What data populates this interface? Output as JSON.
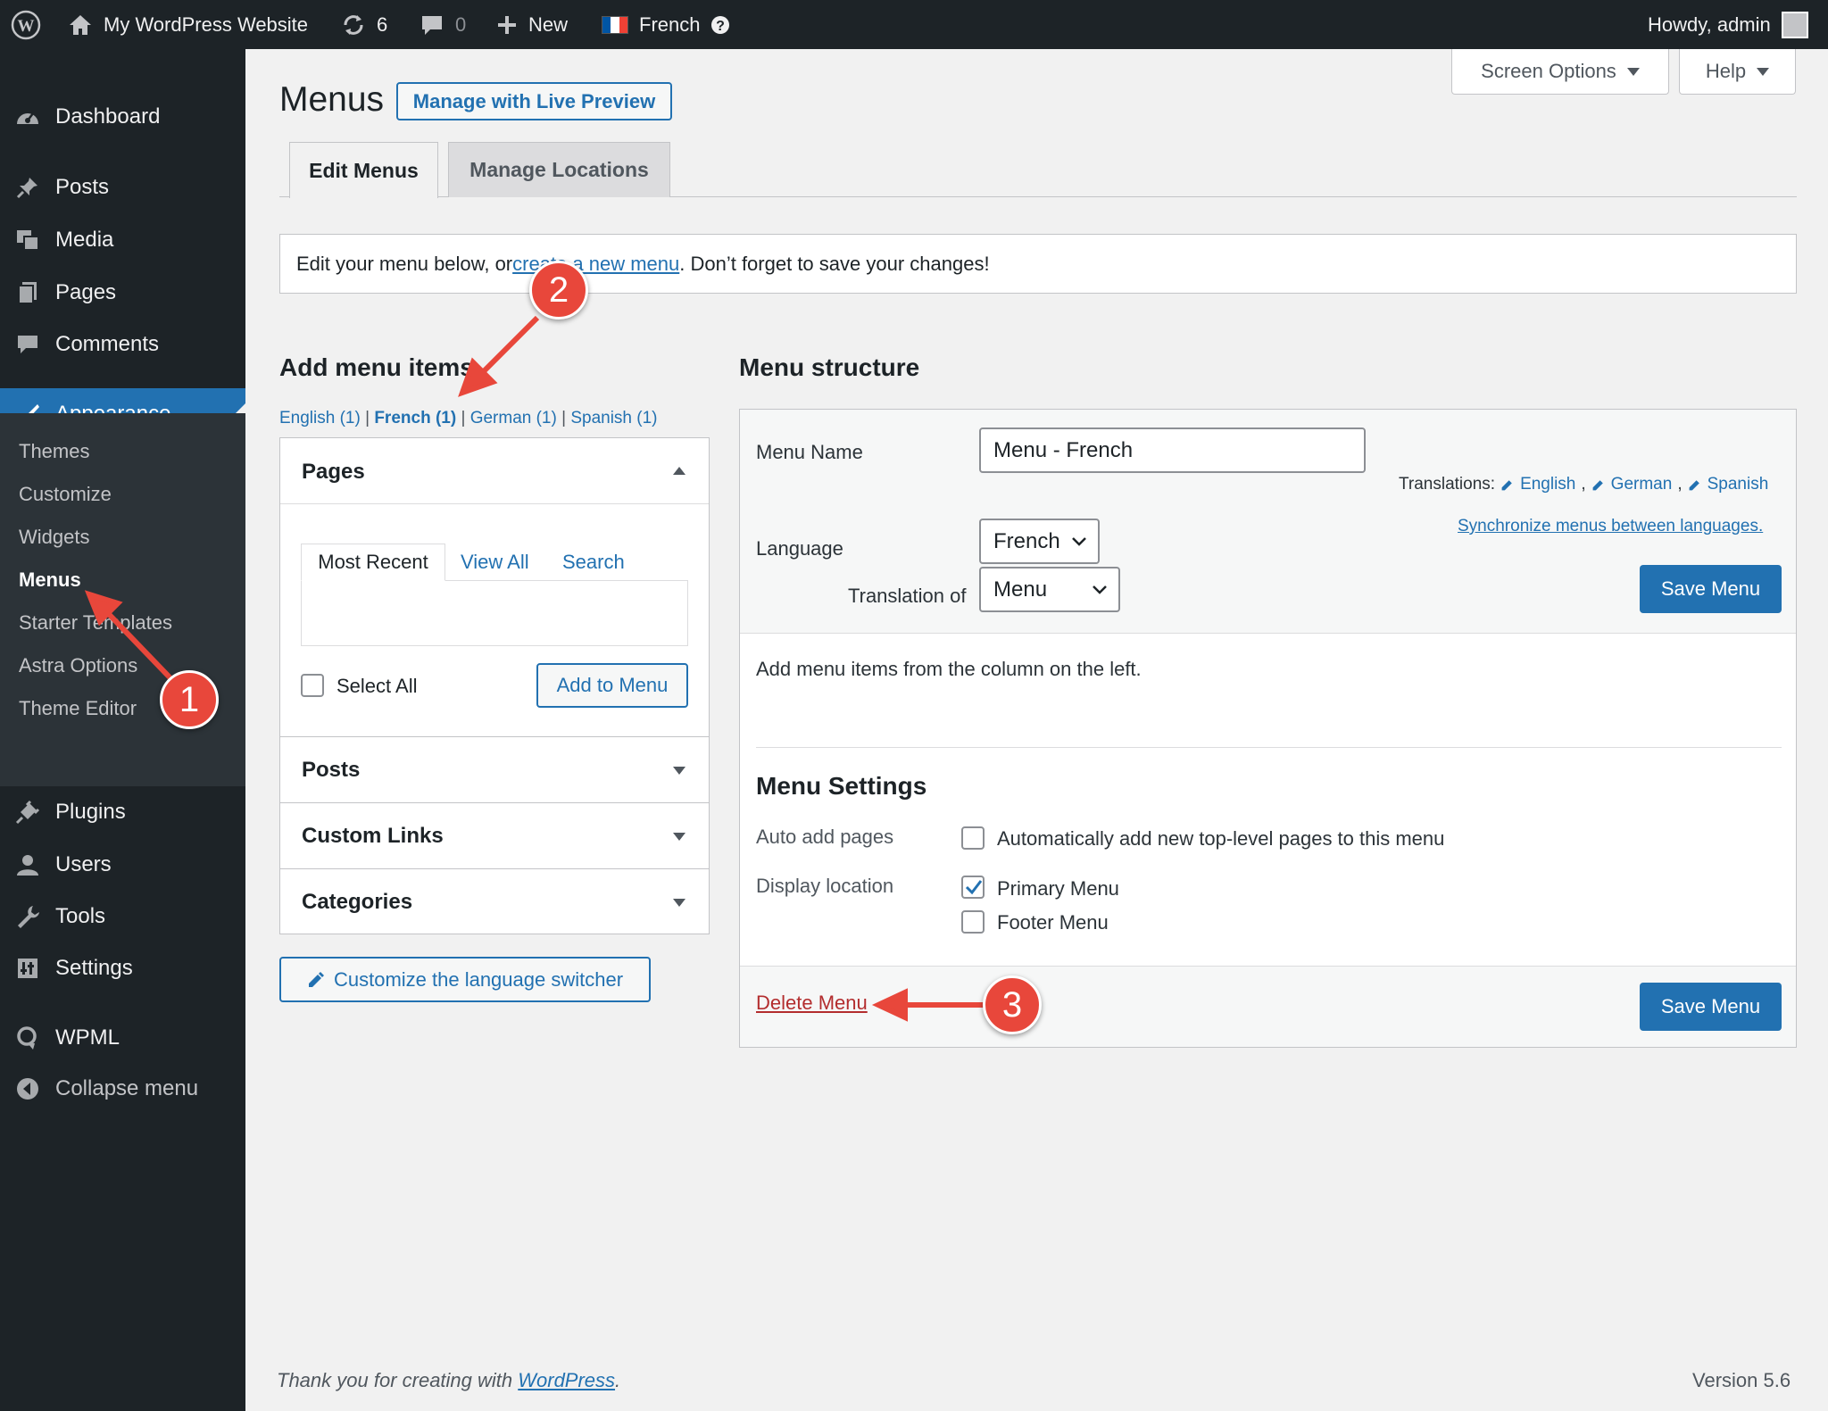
{
  "adminbar": {
    "site_name": "My WordPress Website",
    "updates_count": "6",
    "comments_count": "0",
    "new_label": "New",
    "language_label": "French",
    "howdy": "Howdy, admin"
  },
  "sidebar": {
    "items": [
      {
        "label": "Dashboard",
        "icon": "dashboard-icon"
      },
      {
        "label": "Posts",
        "icon": "pin-icon"
      },
      {
        "label": "Media",
        "icon": "media-icon"
      },
      {
        "label": "Pages",
        "icon": "pages-icon"
      },
      {
        "label": "Comments",
        "icon": "comment-icon"
      },
      {
        "label": "Appearance",
        "icon": "brush-icon"
      },
      {
        "label": "Plugins",
        "icon": "plug-icon"
      },
      {
        "label": "Users",
        "icon": "user-icon"
      },
      {
        "label": "Tools",
        "icon": "wrench-icon"
      },
      {
        "label": "Settings",
        "icon": "settings-icon"
      },
      {
        "label": "WPML",
        "icon": "wpml-icon"
      },
      {
        "label": "Collapse menu",
        "icon": "collapse-icon"
      }
    ],
    "submenu": [
      "Themes",
      "Customize",
      "Widgets",
      "Menus",
      "Starter Templates",
      "Astra Options",
      "Theme Editor"
    ]
  },
  "header": {
    "title": "Menus",
    "live_preview": "Manage with Live Preview",
    "screen_options": "Screen Options",
    "help": "Help"
  },
  "tabs": {
    "edit": "Edit Menus",
    "locations": "Manage Locations"
  },
  "notice": {
    "before": "Edit your menu below, or ",
    "link": "create a new menu",
    "after": ". Don’t forget to save your changes!"
  },
  "add_items": {
    "title": "Add menu items",
    "langs": [
      "English (1)",
      "French (1)",
      "German (1)",
      "Spanish (1)"
    ],
    "pages_title": "Pages",
    "subtabs": [
      "Most Recent",
      "View All",
      "Search"
    ],
    "select_all": "Select All",
    "add_button": "Add to Menu",
    "posts": "Posts",
    "custom_links": "Custom Links",
    "categories": "Categories",
    "lang_switcher": "Customize the language switcher"
  },
  "structure": {
    "title": "Menu structure",
    "menu_name_label": "Menu Name",
    "menu_name_value": "Menu - French",
    "translations_label": "Translations:",
    "translations": [
      "English",
      "German",
      "Spanish"
    ],
    "sync_link": "Synchronize menus between languages.",
    "language_label": "Language",
    "language_value": "French",
    "translation_of_label": "Translation of",
    "translation_of_value": "Menu",
    "save_button": "Save Menu",
    "empty_text": "Add menu items from the column on the left.",
    "settings_title": "Menu Settings",
    "auto_add_label": "Auto add pages",
    "auto_add_option": "Automatically add new top-level pages to this menu",
    "display_location_label": "Display location",
    "primary_menu": "Primary Menu",
    "footer_menu": "Footer Menu",
    "delete_link": "Delete Menu"
  },
  "footer": {
    "thanks_before": "Thank you for creating with ",
    "thanks_link": "WordPress",
    "thanks_after": ".",
    "version": "Version 5.6"
  },
  "markers": [
    "1",
    "2",
    "3"
  ],
  "colors": {
    "accent": "#2271b1",
    "sidebar": "#1d2327",
    "delete": "#b32d2e",
    "marker": "#e8473b"
  }
}
